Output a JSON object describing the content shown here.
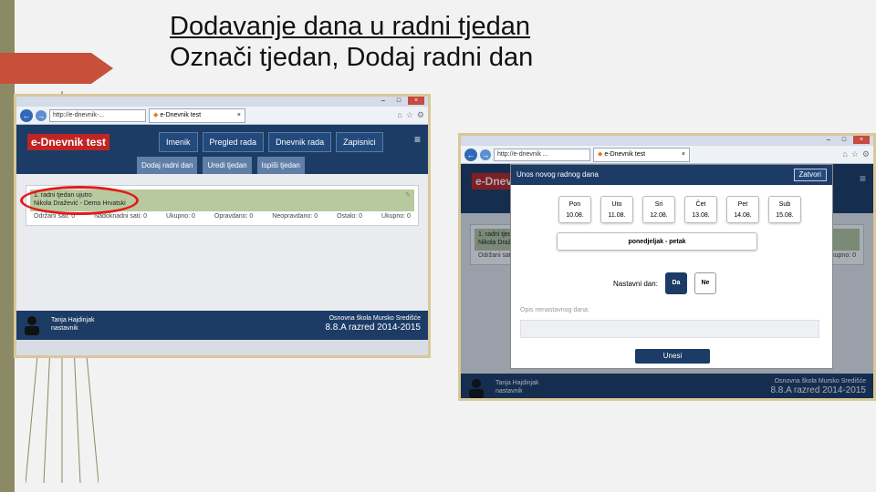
{
  "slide": {
    "title_line1": "Dodavanje dana u radni tjedan",
    "title_line2": "Označi tjedan, Dodaj radni dan"
  },
  "browser": {
    "url": "http://e-dnevnik-...",
    "tab_title": "e-Dnevnik test",
    "url2": "http://e-dnevnik ...",
    "win_controls": [
      "–",
      "□",
      "×"
    ]
  },
  "app": {
    "brand": "e-Dnevnik test",
    "menu": [
      "Imenik",
      "Pregled rada",
      "Dnevnik rada",
      "Zapisnici"
    ],
    "submenu": [
      "Dodaj radni dan",
      "Uredi tjedan",
      "Ispiši tjedan"
    ],
    "week": {
      "line1": "1. radni tjedan ujutro",
      "line2": "Nikola Dražević - Demo Hrvatski",
      "stats": [
        "Održani sati: 0",
        "Nadoknadni sati: 0",
        "Ukupno: 0",
        "Opravdano: 0",
        "Neopravdano: 0",
        "Ostalo: 0",
        "Ukupno: 0"
      ]
    },
    "footer": {
      "user_name": "Tanja Hajdinjak",
      "user_role": "nastavnik",
      "school": "Osnovna škola Mursko Središće",
      "class": "8.8.A razred 2014-2015"
    }
  },
  "modal": {
    "title": "Unos novog radnog dana",
    "close": "Zatvori",
    "days": [
      {
        "name": "Pon",
        "date": "10.08."
      },
      {
        "name": "Uto",
        "date": "11.08."
      },
      {
        "name": "Sri",
        "date": "12.08."
      },
      {
        "name": "Čet",
        "date": "13.08."
      },
      {
        "name": "Pet",
        "date": "14.08."
      },
      {
        "name": "Sub",
        "date": "15.08."
      }
    ],
    "range": "ponedjeljak - petak",
    "nastavni_label": "Nastavni dan:",
    "yes": "Da",
    "no": "Ne",
    "opis_label": "Opis nenastavnog dana:",
    "submit": "Unesi"
  }
}
